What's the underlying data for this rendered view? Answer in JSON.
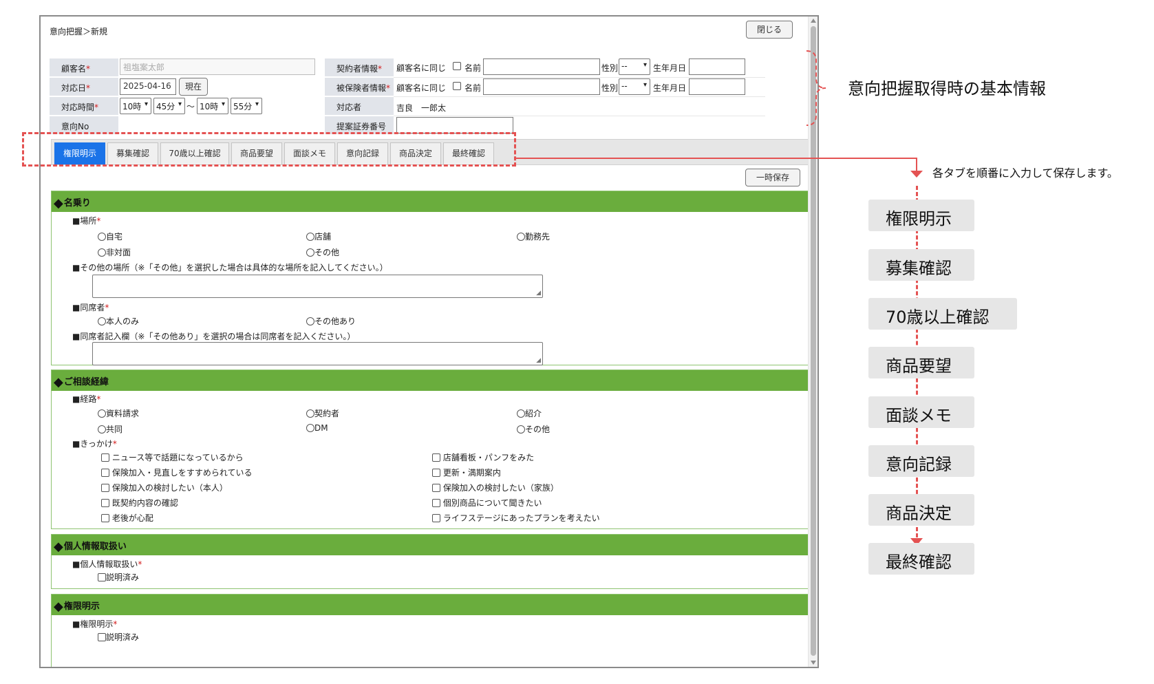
{
  "window": {
    "breadcrumb": "意向把握＞新規",
    "close_label": "閉じる",
    "temp_save_label": "一時保存"
  },
  "basic_info": {
    "customer_name_label": "顧客名",
    "customer_name_value": "祖塩案太郎",
    "response_date_label": "対応日",
    "response_date_value": "2025-04-16",
    "now_button": "現在",
    "response_time_label": "対応時間",
    "time_from_hour": "10時",
    "time_from_min": "45分",
    "time_tilde": "〜",
    "time_to_hour": "10時",
    "time_to_min": "55分",
    "intent_no_label": "意向No",
    "contractor_label": "契約者情報",
    "insured_label": "被保険者情報",
    "same_as_customer": "顧客名に同じ",
    "name_label": "名前",
    "gender_label": "性別",
    "gender_value": "--",
    "birthdate_label": "生年月日",
    "staff_label": "対応者",
    "staff_value": "吉良　一郎太",
    "proposal_no_label": "提案証券番号",
    "required_mark": "*"
  },
  "tabs": [
    {
      "label": "権限明示",
      "active": true
    },
    {
      "label": "募集確認",
      "active": false
    },
    {
      "label": "70歳以上確認",
      "active": false
    },
    {
      "label": "商品要望",
      "active": false
    },
    {
      "label": "面談メモ",
      "active": false
    },
    {
      "label": "意向記録",
      "active": false
    },
    {
      "label": "商品決定",
      "active": false
    },
    {
      "label": "最終確認",
      "active": false
    }
  ],
  "sections": {
    "nanori": {
      "title": "名乗り",
      "place_label": "■場所",
      "place_options": [
        "自宅",
        "店舗",
        "勤務先",
        "非対面",
        "その他"
      ],
      "other_place_label": "■その他の場所（※「その他」を選択した場合は具体的な場所を記入してください。）",
      "companion_label": "■同席者",
      "companion_options": [
        "本人のみ",
        "その他あり"
      ],
      "companion_note_label": "■同席者記入欄（※「その他あり」を選択の場合は同席者を記入ください。）"
    },
    "consultation": {
      "title": "ご相談経緯",
      "route_label": "■経路",
      "route_options": [
        "資料請求",
        "契約者",
        "紹介",
        "共同",
        "DM",
        "その他"
      ],
      "trigger_label": "■きっかけ",
      "trigger_options": [
        "ニュース等で話題になっているから",
        "店舗看板・パンフをみた",
        "保険加入・見直しをすすめられている",
        "更新・満期案内",
        "保険加入の検討したい（本人）",
        "保険加入の検討したい（家族）",
        "既契約内容の確認",
        "個別商品について聞きたい",
        "老後が心配",
        "ライフステージにあったプランを考えたい"
      ]
    },
    "privacy": {
      "title": "個人情報取扱い",
      "field_label": "■個人情報取扱い",
      "check_label": "説明済み"
    },
    "authority": {
      "title": "権限明示",
      "field_label": "■権限明示",
      "check_label": "説明済み"
    }
  },
  "annotations": {
    "basic_info_note": "意向把握取得時の基本情報",
    "tabs_note": "各タブを順番に入力して保存します。",
    "steps": [
      "権限明示",
      "募集確認",
      "70歳以上確認",
      "商品要望",
      "面談メモ",
      "意向記録",
      "商品決定",
      "最終確認"
    ],
    "highlight_color": "#e45252",
    "header_green": "#6aad3d",
    "active_tab_blue": "#1a73e8"
  }
}
